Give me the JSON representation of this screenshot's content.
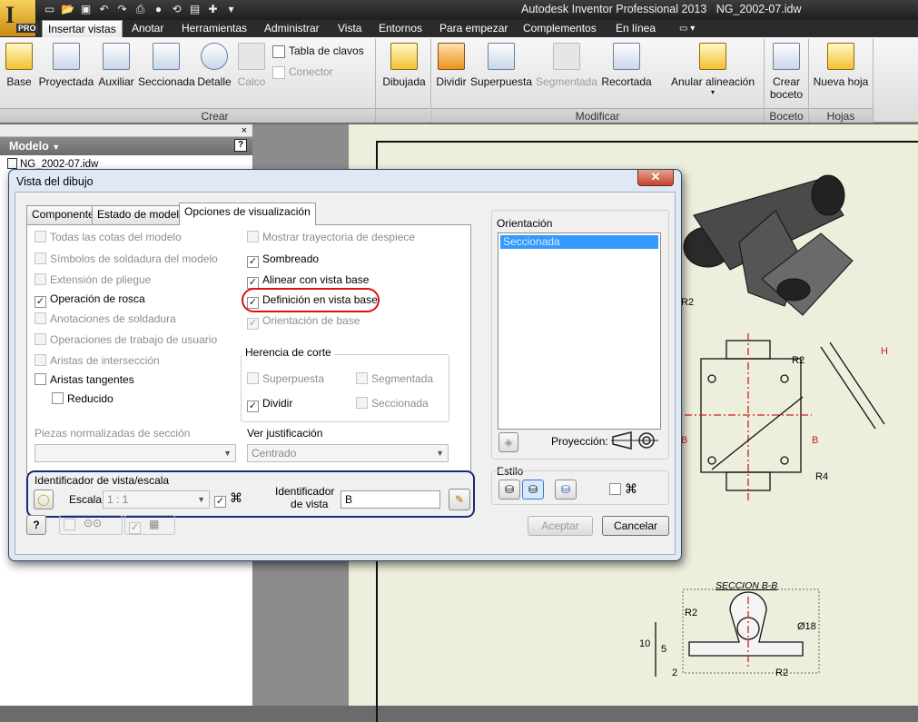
{
  "app": {
    "title": "Autodesk Inventor Professional 2013",
    "document": "NG_2002-07.idw",
    "badge": "PRO",
    "logo_letter": "I",
    "qat_icons": [
      "new-icon",
      "open-icon",
      "save-icon",
      "undo-icon",
      "redo-icon",
      "print-icon",
      "material-icon",
      "update-icon",
      "properties-icon",
      "measure-icon",
      "customize-icon"
    ]
  },
  "ribbon": {
    "tabs": [
      "Insertar vistas",
      "Anotar",
      "Herramientas",
      "Administrar",
      "Vista",
      "Entornos",
      "Para empezar",
      "Complementos",
      "En línea"
    ],
    "active_tab": "Insertar vistas",
    "crear": {
      "label": "Crear",
      "buttons": [
        "Base",
        "Proyectada",
        "Auxiliar",
        "Seccionada",
        "Detalle",
        "Calco"
      ],
      "small": [
        "Tabla de clavos",
        "Conector"
      ]
    },
    "modificar": {
      "label": "Modificar",
      "buttons": [
        "Dibujada",
        "Dividir",
        "Superpuesta",
        "Segmentada",
        "Recortada",
        "Anular alineación"
      ]
    },
    "boceto": {
      "label": "Boceto",
      "buttons": [
        "Crear\nboceto"
      ],
      "b1": "Crear",
      "b2": "boceto"
    },
    "hojas": {
      "label": "Hojas",
      "buttons": [
        "Nueva hoja"
      ]
    }
  },
  "model_panel": {
    "title": "Modelo",
    "help": "?",
    "close": "×",
    "tree_root": "NG_2002-07.idw"
  },
  "dialog": {
    "title": "Vista del dibujo",
    "close": "✕",
    "tabs": [
      "Componente",
      "Estado de modelo",
      "Opciones de visualización"
    ],
    "active_tab": "Opciones de visualización",
    "left_options": [
      {
        "label": "Todas las cotas del modelo",
        "checked": false,
        "disabled": true
      },
      {
        "label": "Símbolos de soldadura del modelo",
        "checked": false,
        "disabled": true
      },
      {
        "label": "Extensión de pliegue",
        "checked": false,
        "disabled": true
      },
      {
        "label": "Operación de rosca",
        "checked": true,
        "disabled": false
      },
      {
        "label": "Anotaciones de soldadura",
        "checked": false,
        "disabled": true
      },
      {
        "label": "Operaciones de trabajo de usuario",
        "checked": false,
        "disabled": true
      },
      {
        "label": "Aristas de intersección",
        "checked": false,
        "disabled": true
      },
      {
        "label": "Aristas tangentes",
        "checked": false,
        "disabled": false
      },
      {
        "label": "Reducido",
        "checked": false,
        "disabled": false
      }
    ],
    "right_options": [
      {
        "label": "Mostrar trayectoria de despiece",
        "checked": false,
        "disabled": true
      },
      {
        "label": "Sombreado",
        "checked": true,
        "disabled": false
      },
      {
        "label": "Alinear con vista base",
        "checked": true,
        "disabled": false
      },
      {
        "label": "Definición en vista base",
        "checked": true,
        "disabled": false
      },
      {
        "label": "Orientación de base",
        "checked": true,
        "disabled": true
      }
    ],
    "herencia": {
      "title": "Herencia de corte",
      "options": [
        {
          "label": "Superpuesta",
          "checked": false,
          "disabled": true
        },
        {
          "label": "Segmentada",
          "checked": false,
          "disabled": true
        },
        {
          "label": "Dividir",
          "checked": true,
          "disabled": false
        },
        {
          "label": "Seccionada",
          "checked": false,
          "disabled": true
        }
      ]
    },
    "piezas_label": "Piezas normalizadas de sección",
    "piezas_value": "",
    "justificacion_label": "Ver justificación",
    "justificacion_value": "Centrado",
    "identificador": {
      "title": "Identificador de vista/escala",
      "escala_label": "Escala",
      "escala_value": "1 : 1",
      "id_label_1": "Identificador",
      "id_label_2": "de vista",
      "id_value": "B"
    },
    "orientacion": {
      "title": "Orientación",
      "items": [
        "Seccionada"
      ]
    },
    "proyeccion_label": "Proyección:",
    "estilo_label": "Estilo",
    "buttons": {
      "ok": "Aceptar",
      "cancel": "Cancelar",
      "help": "?"
    }
  },
  "drawing": {
    "labels": [
      "R2",
      "R2",
      "H",
      "B",
      "B",
      "R4",
      "SECCION B-B",
      "R2",
      "Ø18",
      "R2",
      "10",
      "5",
      "2"
    ]
  }
}
